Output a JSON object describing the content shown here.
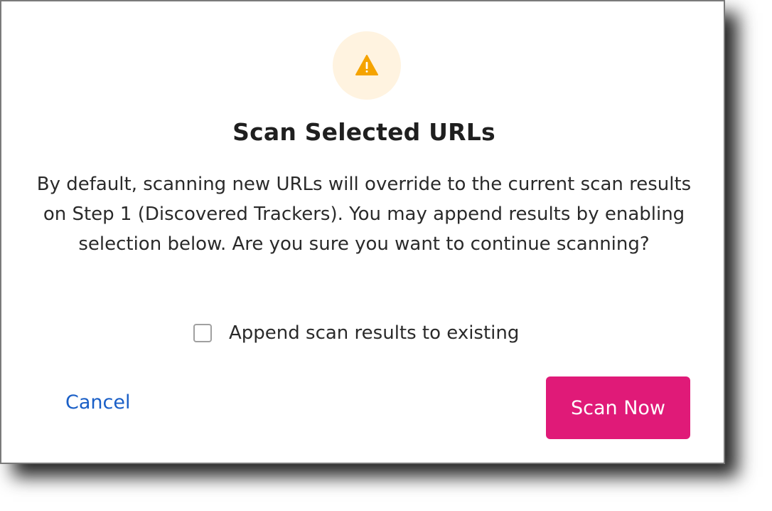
{
  "dialog": {
    "icon": "warning-icon",
    "title": "Scan Selected URLs",
    "message": "By default, scanning new URLs will override to the current scan results on Step 1 (Discovered Trackers). You may append results by enabling selection below. Are you sure you want to continue scanning?",
    "checkbox": {
      "label": "Append scan results to existing",
      "checked": false
    },
    "cancel_label": "Cancel",
    "confirm_label": "Scan Now"
  },
  "colors": {
    "accent": "#e01a78",
    "link": "#1a5fc7",
    "warning": "#f5a300",
    "warning_bg": "#fff3e0"
  }
}
